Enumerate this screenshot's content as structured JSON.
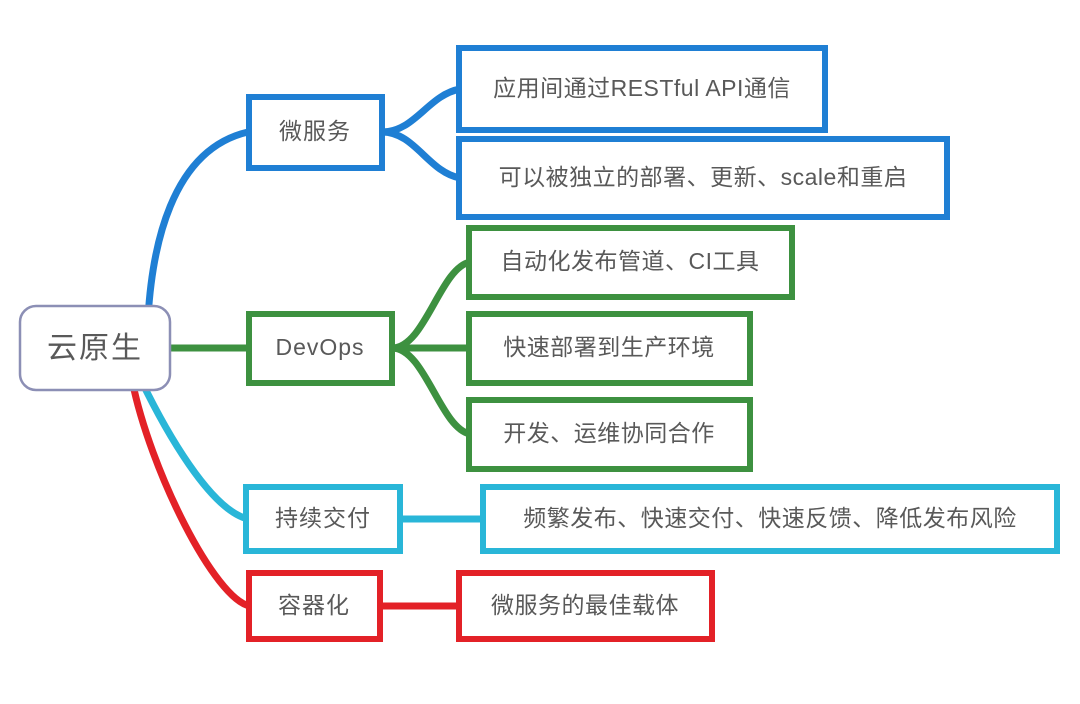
{
  "diagram": {
    "type": "mindmap",
    "title": "云原生",
    "orientation": "left-to-right",
    "background": "#ffffff",
    "root": {
      "label": "云原生",
      "border_color": "#8c8fb5",
      "text_color": "#595959",
      "fill": "#ffffff"
    },
    "branches": [
      {
        "id": "microservices",
        "label": "微服务",
        "color": "#1f7fd4",
        "children": [
          {
            "id": "ms-rest",
            "label": "应用间通过RESTful API通信"
          },
          {
            "id": "ms-deploy",
            "label": "可以被独立的部署、更新、scale和重启"
          }
        ]
      },
      {
        "id": "devops",
        "label": "DevOps",
        "color": "#3d9140",
        "children": [
          {
            "id": "do-pipeline",
            "label": "自动化发布管道、CI工具"
          },
          {
            "id": "do-prod",
            "label": "快速部署到生产环境"
          },
          {
            "id": "do-collab",
            "label": "开发、运维协同合作"
          }
        ]
      },
      {
        "id": "continuous-delivery",
        "label": "持续交付",
        "color": "#29b6d8",
        "children": [
          {
            "id": "cd-release",
            "label": "频繁发布、快速交付、快速反馈、降低发布风险"
          }
        ]
      },
      {
        "id": "containerization",
        "label": "容器化",
        "color": "#e32127",
        "children": [
          {
            "id": "ct-carrier",
            "label": "微服务的最佳载体"
          }
        ]
      }
    ]
  }
}
